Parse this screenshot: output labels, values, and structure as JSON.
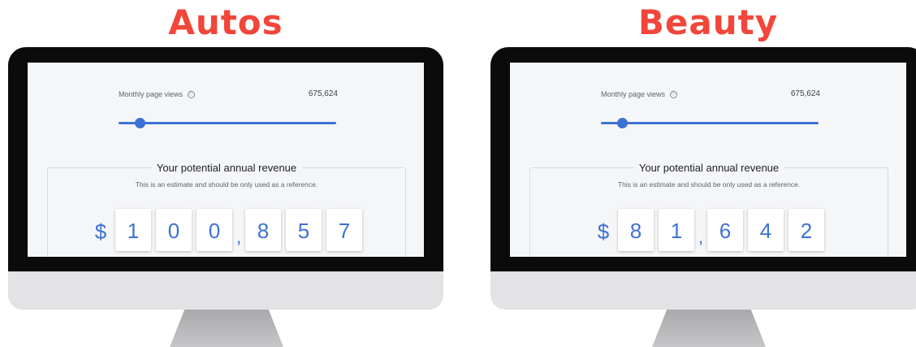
{
  "panels": [
    {
      "category": "Autos",
      "monthly_page_views_label": "Monthly page views",
      "info_icon": "ⓘ",
      "monthly_page_views_value": "675,624",
      "slider_level_fraction": 0.1,
      "revenue_title": "Your potential annual revenue",
      "revenue_subtitle": "This is an estimate and should be only used as a reference.",
      "currency_symbol": "$",
      "digits": [
        "1",
        "0",
        "0",
        "8",
        "5",
        "7"
      ],
      "separator": ","
    },
    {
      "category": "Beauty",
      "monthly_page_views_label": "Monthly page views",
      "info_icon": "ⓘ",
      "monthly_page_views_value": "675,624",
      "slider_level_fraction": 0.1,
      "revenue_title": "Your potential annual revenue",
      "revenue_subtitle": "This is an estimate and should be only used as a reference.",
      "currency_symbol": "$",
      "digits": [
        "8",
        "1",
        "6",
        "4",
        "2"
      ],
      "separator": ","
    }
  ],
  "colors": {
    "title_red": "#f2463a",
    "accent_blue": "#3d72d4",
    "monitor_bezel": "#0b0b0b",
    "screen_bg": "#f5f6f8",
    "monitor_chin": "#e3e3e5",
    "stand_gray": "#b5b5b7"
  }
}
